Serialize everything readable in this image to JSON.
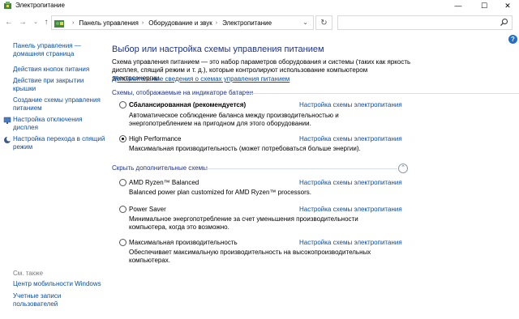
{
  "window": {
    "title": "Электропитание",
    "min_glyph": "—",
    "max_glyph": "☐",
    "close_glyph": "✕"
  },
  "nav": {
    "back_icon": "arrow-left-icon",
    "forward_icon": "arrow-right-icon",
    "recent_icon": "chevron-down-icon",
    "up_icon": "arrow-up-icon",
    "breadcrumbs": [
      "Панель управления",
      "Оборудование и звук",
      "Электропитание"
    ],
    "search_placeholder": ""
  },
  "left_pane": {
    "home_link": "Панель управления — домашняя страница",
    "links": [
      "Действия кнопок питания",
      "Действие при закрытии крышки",
      "Создание схемы управления питанием",
      "Настройка отключения дисплея",
      "Настройка перехода в спящий режим"
    ],
    "see_also_title": "См. также",
    "see_also": [
      "Центр мобильности Windows",
      "Учетные записи пользователей"
    ]
  },
  "main": {
    "heading": "Выбор или настройка схемы управления питанием",
    "intro": "Схема управления питанием — это набор параметров оборудования и системы (таких как яркость дисплея, спящий режим и т. д.), которые контролируют использование компьютером электроэнергии.",
    "intro_link": "Дополнительные сведения о схемах управления питанием",
    "battery_section": "Схемы, отображаемые на индикаторе батареи",
    "hidden_section": "Скрыть дополнительные схемы",
    "plan_link_label": "Настройка схемы электропитания",
    "plans": [
      {
        "name": "Сбалансированная (рекомендуется)",
        "desc": "Автоматическое соблюдение баланса между производительностью и энергопотреблением на пригодном для этого оборудовании.",
        "checked": false
      },
      {
        "name": "High Performance",
        "desc": "Максимальная производительность (может потребоваться больше энергии).",
        "checked": true
      },
      {
        "name": "AMD Ryzen™ Balanced",
        "desc": "Balanced power plan customized for AMD Ryzen™ processors.",
        "checked": false
      },
      {
        "name": "Power Saver",
        "desc": "Минимальное энергопотребление за счет уменьшения производительности компьютера, когда это возможно.",
        "checked": false
      },
      {
        "name": "Максимальная производительность",
        "desc": "Обеспечивает максимальную производительность на высокопроизводительных компьютерах.",
        "checked": false
      }
    ]
  },
  "colors": {
    "link": "#0a4d9e",
    "heading": "#1e3287",
    "help": "#1e6fd0"
  }
}
